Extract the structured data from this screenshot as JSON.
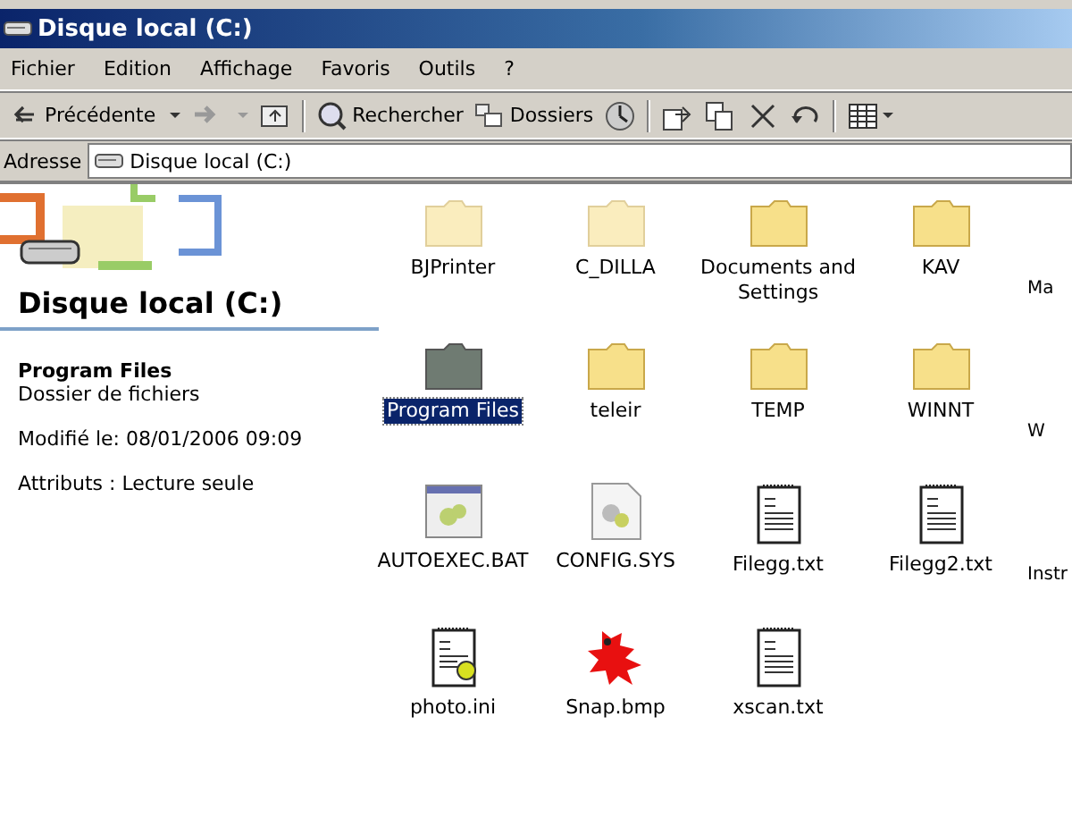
{
  "window": {
    "title": "Disque local (C:)"
  },
  "menu": [
    "Fichier",
    "Edition",
    "Affichage",
    "Favoris",
    "Outils",
    "?"
  ],
  "toolbar": [
    {
      "kind": "back",
      "label": "Précédente",
      "disabled": false
    },
    {
      "kind": "forward",
      "disabled": true
    },
    {
      "kind": "up"
    },
    {
      "kind": "sep"
    },
    {
      "kind": "search",
      "label": "Rechercher"
    },
    {
      "kind": "folders",
      "label": "Dossiers"
    },
    {
      "kind": "history"
    },
    {
      "kind": "sep"
    },
    {
      "kind": "move"
    },
    {
      "kind": "copy"
    },
    {
      "kind": "delete"
    },
    {
      "kind": "undo"
    },
    {
      "kind": "sep"
    },
    {
      "kind": "views"
    }
  ],
  "address": {
    "label": "Adresse",
    "value": "Disque local (C:)"
  },
  "details": {
    "title": "Disque local (C:)",
    "name": "Program Files",
    "type": "Dossier de fichiers",
    "modified": "Modifié le: 08/01/2006 09:09",
    "attributes": "Attributs : Lecture seule"
  },
  "files": [
    {
      "kind": "folder",
      "label": "BJPrinter",
      "hidden": true,
      "selected": false
    },
    {
      "kind": "folder",
      "label": "C_DILLA",
      "hidden": true,
      "selected": false
    },
    {
      "kind": "folder",
      "label": "Documents and Settings",
      "hidden": false,
      "selected": false
    },
    {
      "kind": "folder",
      "label": "KAV",
      "hidden": false,
      "selected": false
    },
    {
      "kind": "partial",
      "label": "Ma",
      "selected": false
    },
    {
      "kind": "folder",
      "label": "Program Files",
      "hidden": false,
      "selected": true
    },
    {
      "kind": "folder",
      "label": "teleir",
      "hidden": false,
      "selected": false
    },
    {
      "kind": "folder",
      "label": "TEMP",
      "hidden": false,
      "selected": false
    },
    {
      "kind": "folder",
      "label": "WINNT",
      "hidden": false,
      "selected": false
    },
    {
      "kind": "partial",
      "label": "W",
      "selected": false
    },
    {
      "kind": "batch",
      "label": "AUTOEXEC.BAT",
      "selected": false
    },
    {
      "kind": "system",
      "label": "CONFIG.SYS",
      "selected": false
    },
    {
      "kind": "text",
      "label": "Filegg.txt",
      "selected": false
    },
    {
      "kind": "text",
      "label": "Filegg2.txt",
      "selected": false
    },
    {
      "kind": "partial",
      "label": "Instr",
      "selected": false
    },
    {
      "kind": "ini",
      "label": "photo.ini",
      "selected": false
    },
    {
      "kind": "image",
      "label": "Snap.bmp",
      "selected": false
    },
    {
      "kind": "text",
      "label": "xscan.txt",
      "selected": false
    }
  ]
}
